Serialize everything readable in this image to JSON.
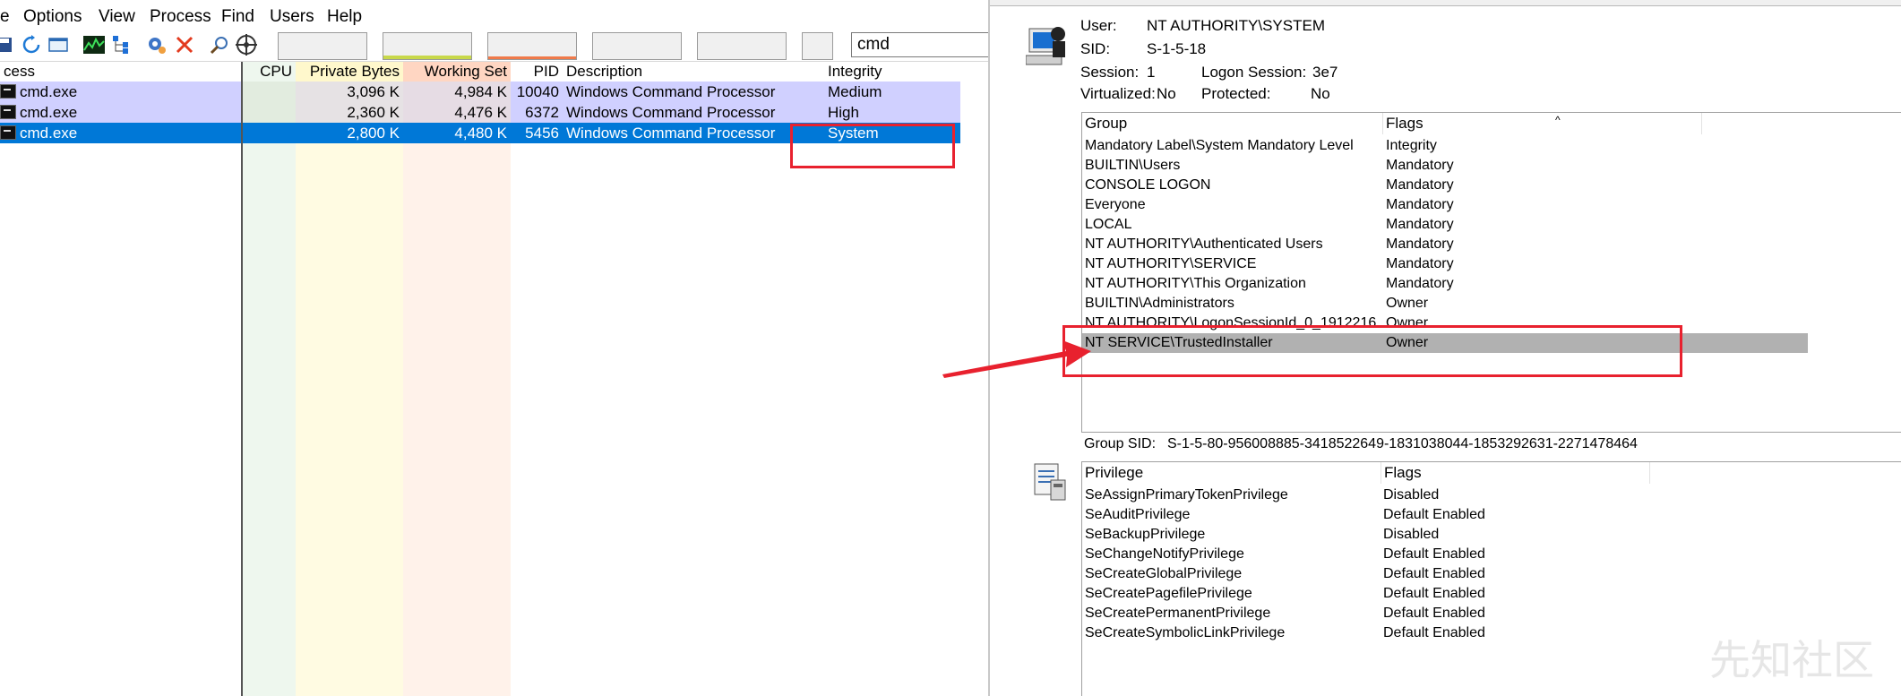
{
  "menu": {
    "file": "e",
    "options": "Options",
    "view": "View",
    "process": "Process",
    "find": "Find",
    "users": "Users",
    "help": "Help"
  },
  "toolbar": {
    "search_value": "cmd",
    "icons": [
      "save-icon",
      "refresh-icon",
      "window-icon",
      "cpu-graph-icon",
      "tree-icon",
      "gear-target-icon",
      "kill-icon",
      "find-icon",
      "crosshair-icon"
    ]
  },
  "process_table": {
    "columns": [
      "cess",
      "CPU",
      "Private Bytes",
      "Working Set",
      "PID",
      "Description",
      "Integrity"
    ],
    "rows": [
      {
        "name": "cmd.exe",
        "cpu": "",
        "private": "3,096 K",
        "working": "4,984 K",
        "pid": "10040",
        "description": "Windows Command Processor",
        "integrity": "Medium"
      },
      {
        "name": "cmd.exe",
        "cpu": "",
        "private": "2,360 K",
        "working": "4,476 K",
        "pid": "6372",
        "description": "Windows Command Processor",
        "integrity": "High"
      },
      {
        "name": "cmd.exe",
        "cpu": "",
        "private": "2,800 K",
        "working": "4,480 K",
        "pid": "5456",
        "description": "Windows Command Processor",
        "integrity": "System"
      }
    ]
  },
  "security": {
    "user_label": "User:",
    "user_value": "NT AUTHORITY\\SYSTEM",
    "sid_label": "SID:",
    "sid_value": "S-1-5-18",
    "session_label": "Session:",
    "session_value": "1",
    "logon_label": "Logon Session:",
    "logon_value": "3e7",
    "virtualized_label": "Virtualized:",
    "virtualized_value": "No",
    "protected_label": "Protected:",
    "protected_value": "No",
    "group_header": "Group",
    "flags_header": "Flags",
    "groups": [
      {
        "group": "Mandatory Label\\System Mandatory Level",
        "flags": "Integrity"
      },
      {
        "group": "BUILTIN\\Users",
        "flags": "Mandatory"
      },
      {
        "group": "CONSOLE LOGON",
        "flags": "Mandatory"
      },
      {
        "group": "Everyone",
        "flags": "Mandatory"
      },
      {
        "group": "LOCAL",
        "flags": "Mandatory"
      },
      {
        "group": "NT AUTHORITY\\Authenticated Users",
        "flags": "Mandatory"
      },
      {
        "group": "NT AUTHORITY\\SERVICE",
        "flags": "Mandatory"
      },
      {
        "group": "NT AUTHORITY\\This Organization",
        "flags": "Mandatory"
      },
      {
        "group": "BUILTIN\\Administrators",
        "flags": "Owner"
      },
      {
        "group": "NT AUTHORITY\\LogonSessionId_0_1912216",
        "flags": "Owner"
      },
      {
        "group": "NT SERVICE\\TrustedInstaller",
        "flags": "Owner"
      }
    ],
    "selected_group_index": 10,
    "group_sid_label": "Group SID:",
    "group_sid_value": "S-1-5-80-956008885-3418522649-1831038044-1853292631-2271478464",
    "privilege_header": "Privilege",
    "privilege_flags_header": "Flags",
    "privileges": [
      {
        "name": "SeAssignPrimaryTokenPrivilege",
        "flags": "Disabled"
      },
      {
        "name": "SeAuditPrivilege",
        "flags": "Default Enabled"
      },
      {
        "name": "SeBackupPrivilege",
        "flags": "Disabled"
      },
      {
        "name": "SeChangeNotifyPrivilege",
        "flags": "Default Enabled"
      },
      {
        "name": "SeCreateGlobalPrivilege",
        "flags": "Default Enabled"
      },
      {
        "name": "SeCreatePagefilePrivilege",
        "flags": "Default Enabled"
      },
      {
        "name": "SeCreatePermanentPrivilege",
        "flags": "Default Enabled"
      },
      {
        "name": "SeCreateSymbolicLinkPrivilege",
        "flags": "Default Enabled"
      }
    ]
  },
  "watermark": "先知社区",
  "colors": {
    "row_highlight": "#d0d0ff",
    "selected_row": "#0078d7",
    "annotation": "#e8212e",
    "private_bytes_col": "#fffbe0",
    "working_set_col": "#fff0e8",
    "cpu_col": "#e8f5e8"
  }
}
